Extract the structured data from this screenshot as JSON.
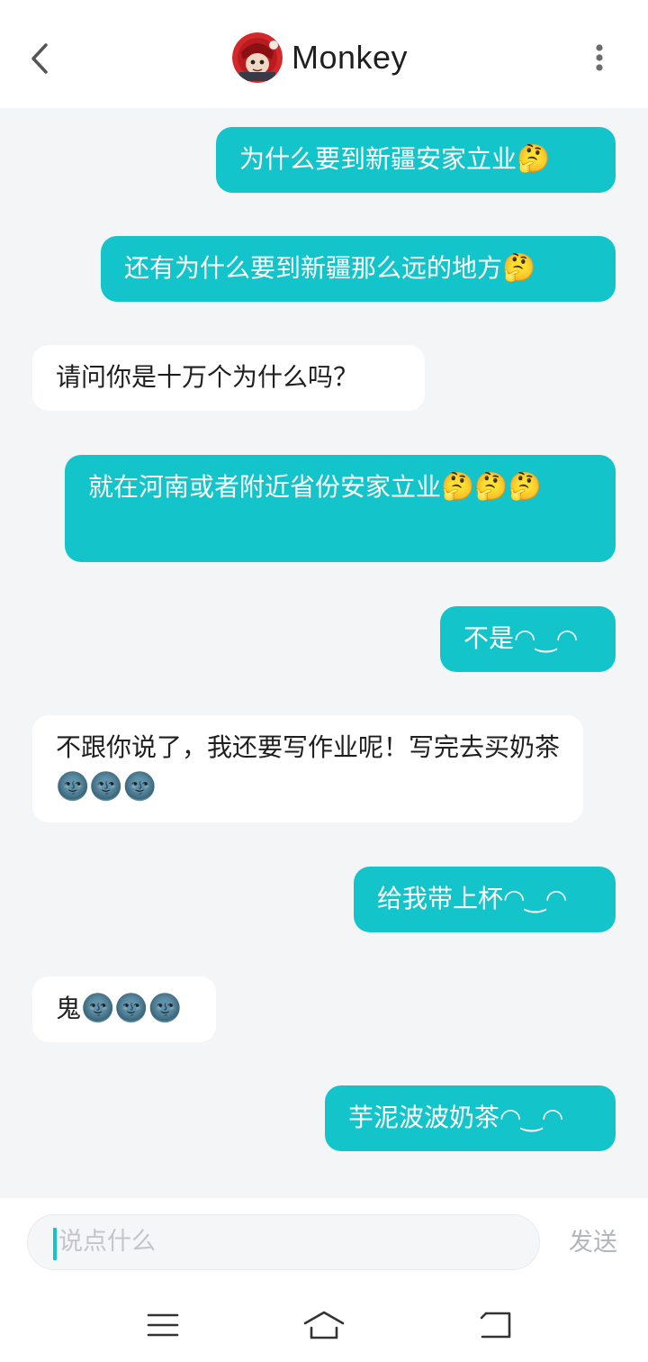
{
  "header": {
    "title": "Monkey",
    "back_icon": "chevron-left-icon",
    "more_icon": "more-vertical-icon"
  },
  "messages": [
    {
      "side": "out",
      "text": "为什么要到新疆安家立业",
      "emoji": "🤔"
    },
    {
      "side": "out",
      "text": "还有为什么要到新疆那么远的地方",
      "emoji": "🤔"
    },
    {
      "side": "in",
      "text": "请问你是十万个为什么吗？",
      "emoji": ""
    },
    {
      "side": "out",
      "text": "就在河南或者附近省份安家立业",
      "emoji": "🤔🤔🤔"
    },
    {
      "side": "out",
      "text": "不是◠‿◠",
      "emoji": ""
    },
    {
      "side": "in",
      "text": "不跟你说了，我还要写作业呢！写完去买奶茶",
      "emoji": "🌚🌚🌚"
    },
    {
      "side": "out",
      "text": "给我带上杯◠‿◠",
      "emoji": ""
    },
    {
      "side": "in",
      "text": "鬼",
      "emoji": "🌚🌚🌚"
    },
    {
      "side": "out",
      "text": "芋泥波波奶茶◠‿◠",
      "emoji": ""
    }
  ],
  "input": {
    "placeholder": "说点什么",
    "send_label": "发送"
  },
  "nav": {
    "menu_icon": "menu-icon",
    "home_icon": "home-icon",
    "back_icon": "back-arrow-icon"
  },
  "colors": {
    "outgoing_bubble": "#13c4ca",
    "incoming_bubble": "#ffffff",
    "chat_background": "#f3f5f7"
  }
}
